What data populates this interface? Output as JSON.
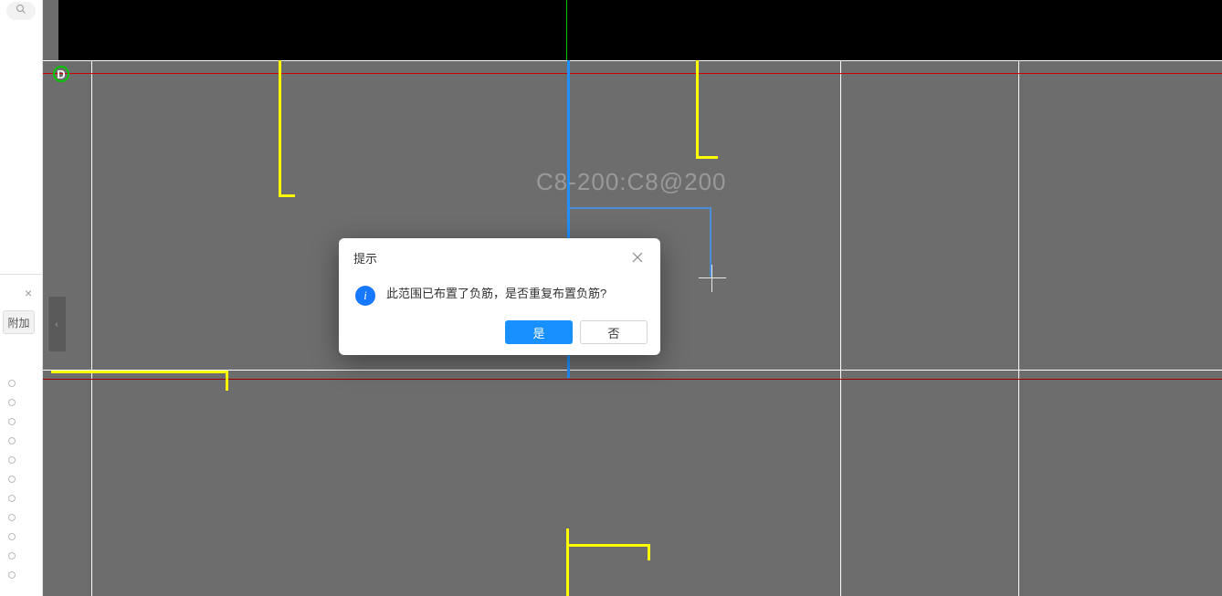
{
  "sidebar": {
    "tab_label": "附加",
    "close_symbol": "×"
  },
  "canvas": {
    "grid_marker": "D",
    "rebar_label": "C8-200:C8@200",
    "navcube_symbol": "‹"
  },
  "dialog": {
    "title": "提示",
    "message": "此范围已布置了负筋，是否重复布置负筋?",
    "info_glyph": "i",
    "confirm_label": "是",
    "cancel_label": "否"
  }
}
